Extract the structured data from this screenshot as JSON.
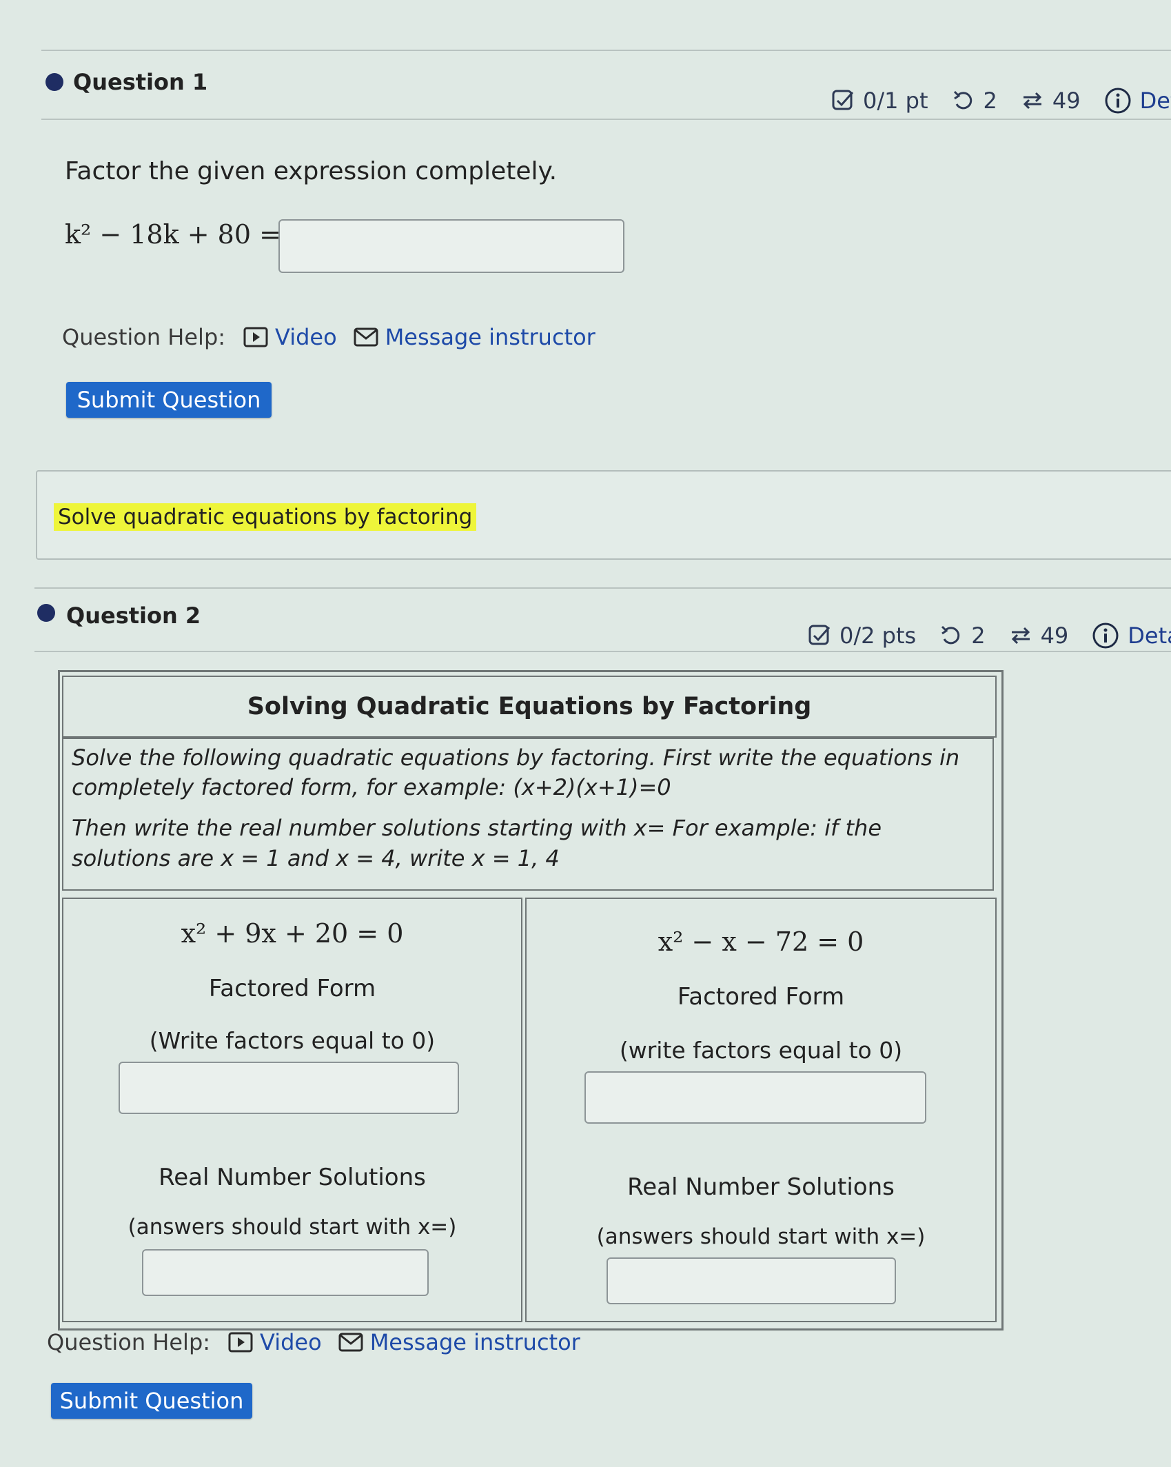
{
  "question1": {
    "title": "Question 1",
    "score": "0/1 pt",
    "retries": "2",
    "attempts": "49",
    "details": "Details",
    "prompt": "Factor the given expression completely.",
    "expression": "k² − 18k + 80 =",
    "answer_value": "",
    "help_label": "Question Help:",
    "video_label": "Video",
    "message_label": "Message instructor",
    "submit_label": "Submit Question"
  },
  "outcome": {
    "text": "Solve quadratic equations by factoring"
  },
  "question2": {
    "title": "Question 2",
    "score": "0/2 pts",
    "retries": "2",
    "attempts": "49",
    "details": "Details",
    "table_title": "Solving Quadratic Equations by Factoring",
    "instructions_1": "Solve the following quadratic equations by factoring. First write the equations in completely factored form, for example: (x+2)(x+1)=0",
    "instructions_2": "Then write the real number solutions starting with x= For example: if the solutions are x = 1 and x = 4, write x = 1, 4",
    "left": {
      "equation": "x² + 9x + 20 = 0",
      "factored_heading": "Factored Form",
      "factored_note": "(Write factors equal to 0)",
      "factored_value": "",
      "solutions_heading": "Real Number Solutions",
      "solutions_note": "(answers should start with x=)",
      "solutions_value": ""
    },
    "right": {
      "equation": "x² − x − 72 = 0",
      "factored_heading": "Factored Form",
      "factored_note": "(write factors equal to 0)",
      "factored_value": "",
      "solutions_heading": "Real Number Solutions",
      "solutions_note": "(answers should start with x=)",
      "solutions_value": ""
    },
    "help_label": "Question Help:",
    "video_label": "Video",
    "message_label": "Message instructor",
    "submit_label": "Submit Question"
  },
  "colors": {
    "accent": "#1f68c9",
    "link": "#1e4aa8",
    "bullet": "#1f2d63",
    "highlight": "#eef53a"
  },
  "icons": [
    "checkbox-icon",
    "retry-icon",
    "attempts-icon",
    "info-icon",
    "video-icon",
    "envelope-icon"
  ]
}
